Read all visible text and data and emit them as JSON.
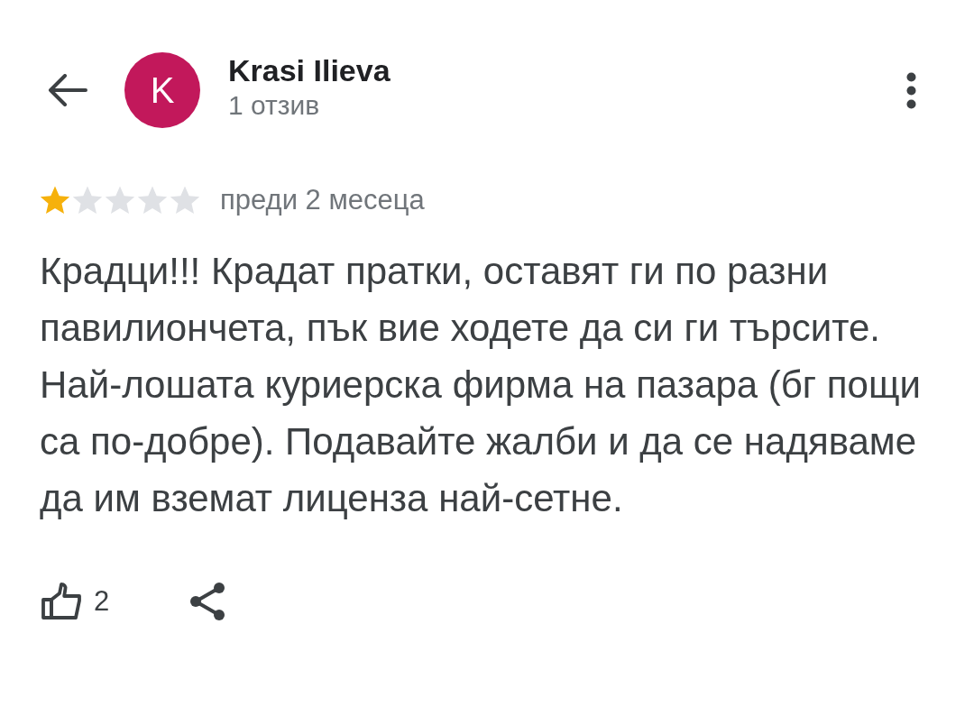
{
  "header": {
    "avatar_letter": "K",
    "name": "Krasi Ilieva",
    "review_count": "1 отзив"
  },
  "review": {
    "stars": 1,
    "time": "преди 2 месеца",
    "text": "Крадци!!! Крадат пратки, оставят ги по разни павилиончета, пък вие ходете да си ги търсите. Най-лошата куриерска фирма на пазара (бг пощи са по-добре). Подавайте жалби и да се надяваме да им вземат лиценза най-сетне.",
    "likes": "2"
  }
}
